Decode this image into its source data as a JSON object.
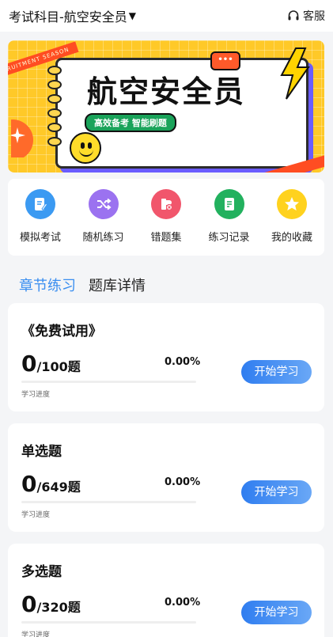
{
  "header": {
    "subject_prefix": "考试科目- ",
    "subject_name": "航空安全员",
    "dropdown_arrow": "▼",
    "service_label": "客服",
    "service_icon": "headset-icon"
  },
  "banner": {
    "title": "航空安全员",
    "subtitle": "高效备考 智能刷题",
    "ribbon_text": "RECRUITMENT SEASON",
    "bubble_text": "•••",
    "colors": {
      "background": "#ffc928",
      "ribbon": "#ff4d22",
      "badge": "#1aa35a"
    }
  },
  "quick_menu": [
    {
      "label": "模拟考试",
      "icon": "mock-exam-icon",
      "color": "#3b9af2"
    },
    {
      "label": "随机练习",
      "icon": "shuffle-icon",
      "color": "#9b72f0"
    },
    {
      "label": "错题集",
      "icon": "wrong-questions-icon",
      "color": "#f1566c"
    },
    {
      "label": "练习记录",
      "icon": "practice-record-icon",
      "color": "#22b15e"
    },
    {
      "label": "我的收藏",
      "icon": "star-icon",
      "color": "#ffd21e"
    }
  ],
  "tabs": [
    {
      "label": "章节练习",
      "active": true
    },
    {
      "label": "题库详情",
      "active": false
    }
  ],
  "cards": [
    {
      "title": "《免费试用》",
      "done": "0",
      "total": "/100题",
      "percent": "0.00%",
      "progress": 0,
      "progress_label": "学习进度",
      "button": "开始学习"
    },
    {
      "title": "单选题",
      "done": "0",
      "total": "/649题",
      "percent": "0.00%",
      "progress": 0,
      "progress_label": "学习进度",
      "button": "开始学习"
    },
    {
      "title": "多选题",
      "done": "0",
      "total": "/320题",
      "percent": "0.00%",
      "progress": 0,
      "progress_label": "学习进度",
      "button": "开始学习"
    }
  ],
  "accent_color": "#3a8ef0"
}
